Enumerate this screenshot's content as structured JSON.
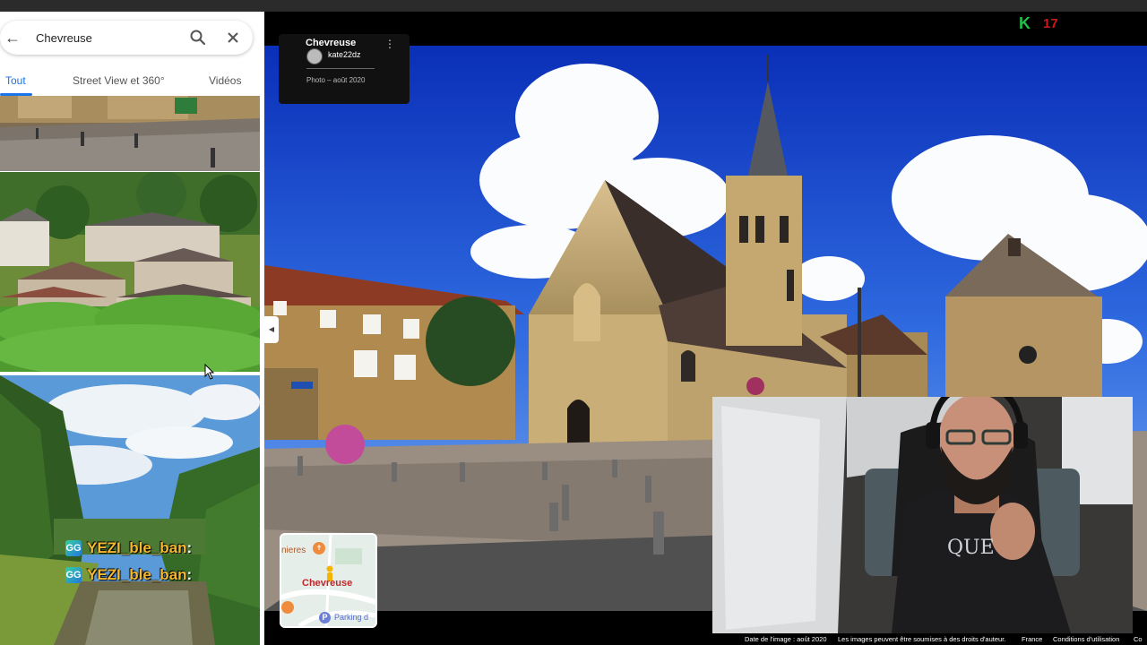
{
  "browser": {
    "bookmarks": [
      "",
      "",
      ""
    ]
  },
  "search": {
    "value": "Chevreuse",
    "back_icon": "arrow-left-icon",
    "search_icon": "search-icon",
    "close_icon": "close-icon"
  },
  "tabs": [
    {
      "label": "Tout",
      "active": true
    },
    {
      "label": "Street View et 360°",
      "active": false
    },
    {
      "label": "Vidéos",
      "active": false
    }
  ],
  "chat": [
    {
      "badge": "GG",
      "user": "YEZI_ble_ban",
      "sep": ":"
    },
    {
      "badge": "GG",
      "user": "YEZI_ble_ban",
      "sep": ":"
    }
  ],
  "photo_card": {
    "title": "Chevreuse",
    "menu_icon": "more-vert-icon",
    "author": "kate22dz",
    "date": "Photo – août 2020"
  },
  "minimap": {
    "labels": [
      "nieres",
      "Chevreuse",
      "Parking d"
    ],
    "pin_icon": "pegman-icon",
    "restaurant_icon": "restaurant-icon",
    "parking_icon": "parking-icon"
  },
  "overlay": {
    "k_logo": "K",
    "counter": "17",
    "accent": "#21c048",
    "counter_color": "#d01616"
  },
  "footer": {
    "image_date": "Date de l'image : août 2020",
    "rights": "Les images peuvent être soumises à des droits d'auteur.",
    "country": "France",
    "terms": "Conditions d'utilisation",
    "more": "Co"
  }
}
